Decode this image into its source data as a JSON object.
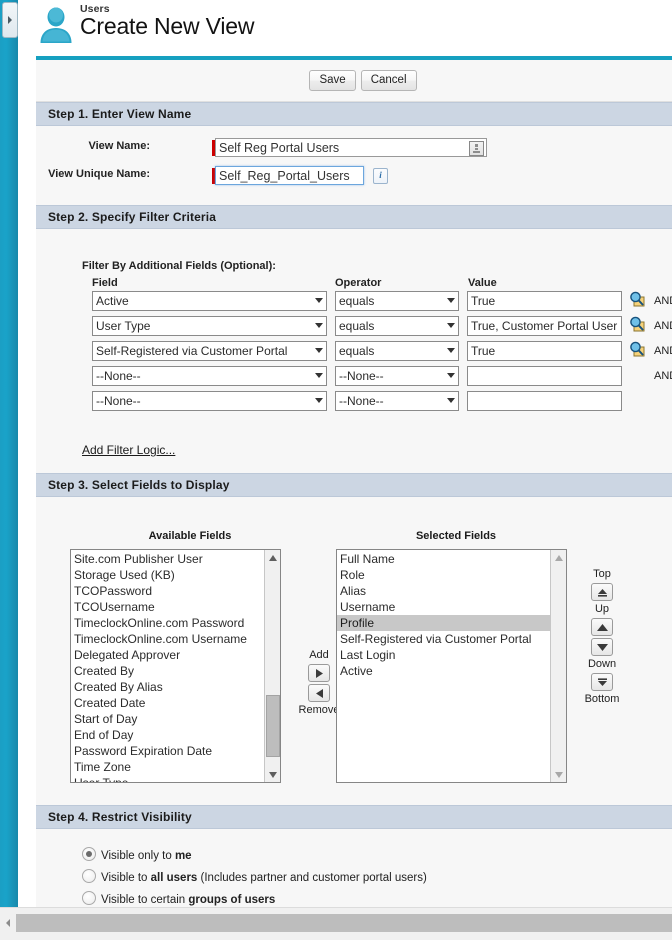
{
  "header": {
    "breadcrumb": "Users",
    "title": "Create New View",
    "user_icon": "user-avatar-icon"
  },
  "toolbar": {
    "save_label": "Save",
    "cancel_label": "Cancel"
  },
  "step1": {
    "heading": "Step 1. Enter View Name",
    "view_name_label": "View Name:",
    "view_name_value": "Self Reg Portal Users",
    "view_unique_name_label": "View Unique Name:",
    "view_unique_name_value": "Self_Reg_Portal_Users",
    "info_icon_label": "i"
  },
  "step2": {
    "heading": "Step 2. Specify Filter Criteria",
    "filter_title": "Filter By Additional Fields (Optional):",
    "col_field": "Field",
    "col_operator": "Operator",
    "col_value": "Value",
    "and_label": "AND",
    "add_filter_logic": "Add Filter Logic...",
    "rows": [
      {
        "field": "Active",
        "operator": "equals",
        "value": "True",
        "has_lookup": true,
        "and": "AND"
      },
      {
        "field": "User Type",
        "operator": "equals",
        "value": "True, Customer Portal User",
        "has_lookup": true,
        "and": "AND"
      },
      {
        "field": "Self-Registered via Customer Portal",
        "operator": "equals",
        "value": "True",
        "has_lookup": true,
        "and": "AND"
      },
      {
        "field": "--None--",
        "operator": "--None--",
        "value": "",
        "has_lookup": false,
        "and": "AND"
      },
      {
        "field": "--None--",
        "operator": "--None--",
        "value": "",
        "has_lookup": false,
        "and": ""
      }
    ]
  },
  "step3": {
    "heading": "Step 3. Select Fields to Display",
    "available_label": "Available Fields",
    "selected_label": "Selected Fields",
    "add_label": "Add",
    "remove_label": "Remove",
    "top_label": "Top",
    "up_label": "Up",
    "down_label": "Down",
    "bottom_label": "Bottom",
    "available_fields": [
      "Site.com Publisher User",
      "Storage Used (KB)",
      "TCOPassword",
      "TCOUsername",
      "TimeclockOnline.com Password",
      "TimeclockOnline.com Username",
      "Delegated Approver",
      "Created By",
      "Created By Alias",
      "Created Date",
      "Start of Day",
      "End of Day",
      "Password Expiration Date",
      "Time Zone",
      "User Type"
    ],
    "selected_fields": [
      "Full Name",
      "Role",
      "Alias",
      "Username",
      "Profile",
      "Self-Registered via Customer Portal",
      "Last Login",
      "Active"
    ],
    "selected_highlight_index": 4
  },
  "step4": {
    "heading": "Step 4. Restrict Visibility",
    "options": [
      {
        "pre": "Visible only to ",
        "strong": "me",
        "post": "",
        "checked": true
      },
      {
        "pre": "Visible to ",
        "strong": "all users",
        "post": " (Includes partner and customer portal users)",
        "checked": false
      },
      {
        "pre": "Visible to certain ",
        "strong": "groups of users",
        "post": "",
        "checked": false
      }
    ]
  },
  "colors": {
    "accent_teal": "#16a0c0",
    "section_header": "#ccd6e3",
    "required_marker": "#cc0000",
    "selected_row": "#c8c8c8"
  }
}
